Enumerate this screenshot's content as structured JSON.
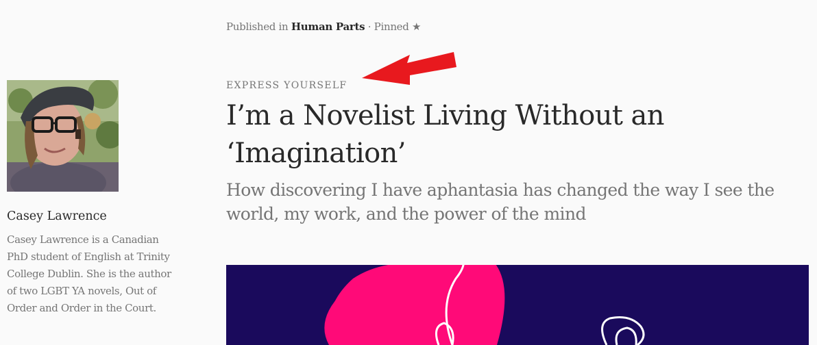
{
  "publication": {
    "prefix": "Published in",
    "name": "Human Parts",
    "separator": "·",
    "pinned_label": "Pinned",
    "pinned_icon": "star-icon"
  },
  "author": {
    "name": "Casey Lawrence",
    "bio": "Casey Lawrence is a Canadian PhD student of English at Trinity College Dublin. She is the author of two LGBT YA novels, Out of Order and Order in the Court."
  },
  "article": {
    "kicker": "EXPRESS YOURSELF",
    "title": "I’m a Novelist Living Without an ‘Imagination’",
    "subtitle": "How discovering I have aphantasia has changed the way I see the world, my work, and the power of the mind"
  },
  "colors": {
    "background": "#fafafa",
    "text_primary": "#292929",
    "text_secondary": "#757575",
    "annotation_arrow": "#e8191e",
    "hero_navy": "#1a0a5c",
    "hero_pink": "#ff0a78"
  }
}
